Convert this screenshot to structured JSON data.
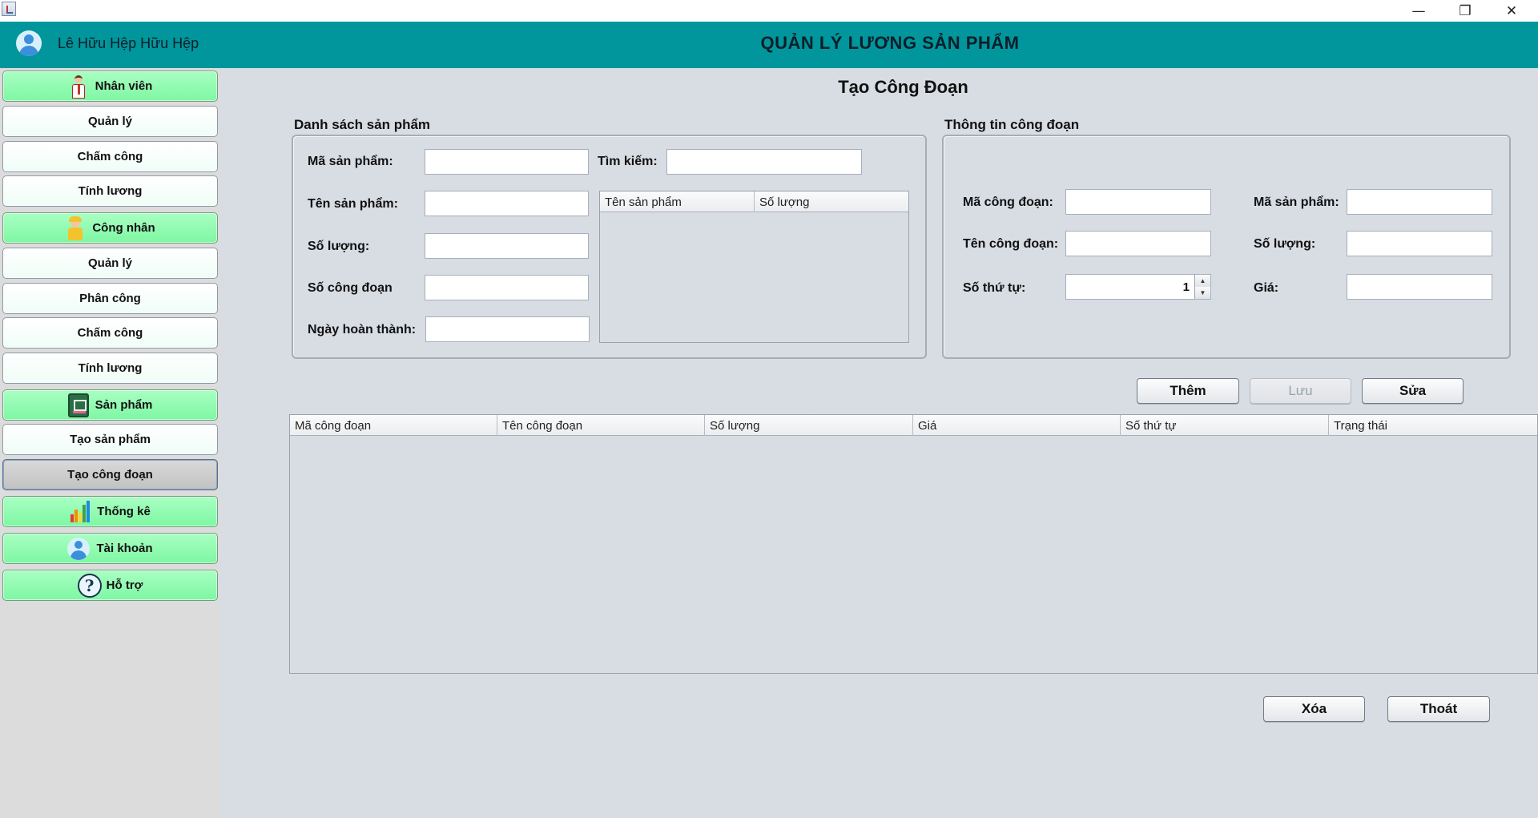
{
  "window": {
    "minimize": "—",
    "restore": "❐",
    "close": "✕"
  },
  "header": {
    "user_name": "Lê Hữu Hệp Hữu Hệp",
    "app_title": "QUẢN LÝ LƯƠNG SẢN PHẨM"
  },
  "sidebar": {
    "items": [
      {
        "label": "Nhân viên",
        "style": "green",
        "icon": "employee-icon"
      },
      {
        "label": "Quản lý",
        "style": "white"
      },
      {
        "label": "Chấm công",
        "style": "white"
      },
      {
        "label": "Tính lương",
        "style": "white"
      },
      {
        "label": "Công nhân",
        "style": "green",
        "icon": "worker-icon"
      },
      {
        "label": "Quản lý",
        "style": "white"
      },
      {
        "label": "Phân công",
        "style": "white"
      },
      {
        "label": "Chấm công",
        "style": "white"
      },
      {
        "label": "Tính lương",
        "style": "white"
      },
      {
        "label": "Sản phẩm",
        "style": "green",
        "icon": "product-icon"
      },
      {
        "label": "Tạo sản phẩm",
        "style": "white"
      },
      {
        "label": "Tạo công đoạn",
        "style": "active"
      },
      {
        "label": "Thống kê",
        "style": "green",
        "icon": "bar-chart-icon"
      },
      {
        "label": "Tài khoản",
        "style": "green",
        "icon": "account-icon"
      },
      {
        "label": "Hỗ trợ",
        "style": "green",
        "icon": "help-icon"
      }
    ],
    "help_glyph": "?"
  },
  "page": {
    "title": "Tạo Công Đoạn"
  },
  "product_list": {
    "title": "Danh sách sản phẩm",
    "labels": {
      "product_code": "Mã sản phẩm:",
      "search": "Tìm kiếm:",
      "product_name": "Tên sản phẩm:",
      "quantity": "Số lượng:",
      "stage_count": "Số công đoạn",
      "completion_date": "Ngày hoàn thành:"
    },
    "values": {
      "product_code": "",
      "search": "",
      "product_name": "",
      "quantity": "",
      "stage_count": "",
      "completion_date": ""
    },
    "table_columns": [
      "Tên sản phẩm",
      "Số lượng"
    ]
  },
  "stage_info": {
    "title": "Thông tin công đoạn",
    "labels": {
      "stage_code": "Mã công đoạn:",
      "product_code": "Mã sản phẩm:",
      "stage_name": "Tên công đoạn:",
      "quantity": "Số lượng:",
      "order": "Số thứ tự:",
      "price": "Giá:"
    },
    "values": {
      "stage_code": "",
      "product_code": "",
      "stage_name": "",
      "quantity": "",
      "order": "1",
      "price": ""
    },
    "spinner_up": "▲",
    "spinner_down": "▼"
  },
  "actions": {
    "add": "Thêm",
    "save": "Lưu",
    "edit": "Sửa",
    "delete": "Xóa",
    "exit": "Thoát"
  },
  "stage_table": {
    "columns": [
      "Mã công đoạn",
      "Tên công đoạn",
      "Số lượng",
      "Giá",
      "Số thứ tự",
      "Trạng thái"
    ]
  }
}
